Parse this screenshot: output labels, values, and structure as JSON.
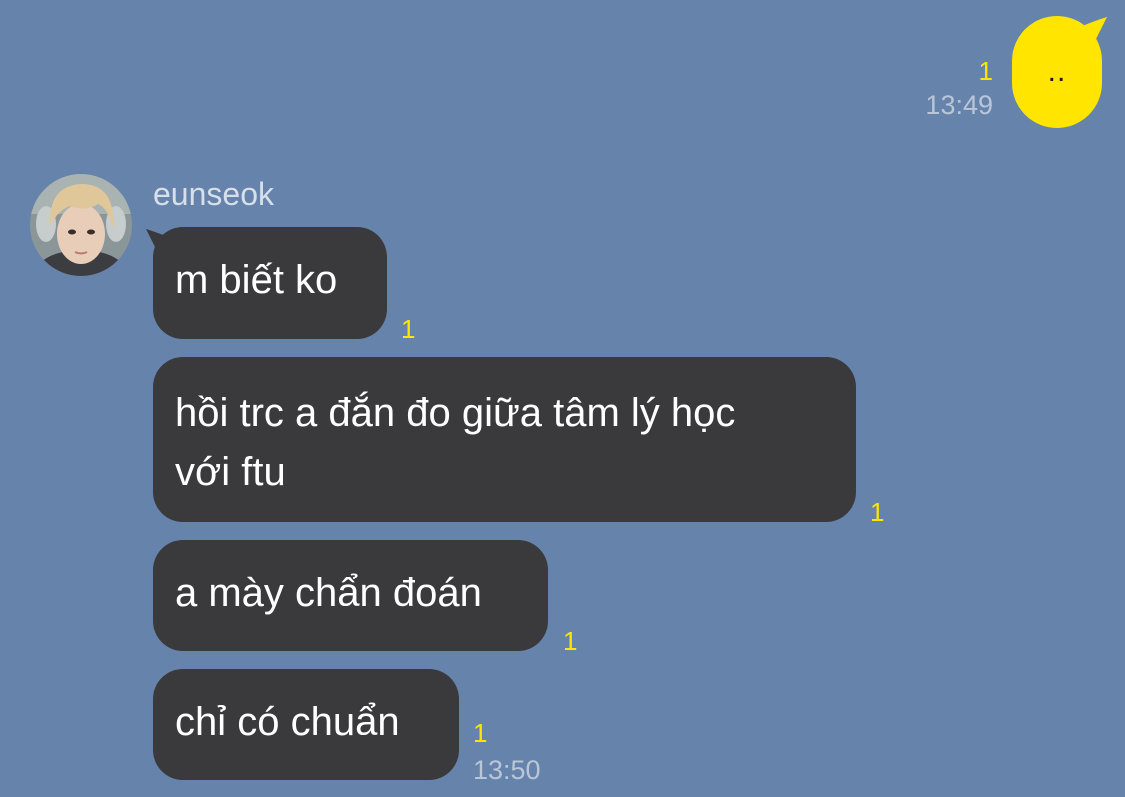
{
  "colors": {
    "background": "#6683AC",
    "outgoing_bubble": "#FFE500",
    "incoming_bubble": "#3A393C",
    "unread_count": "#FFE500",
    "timestamp": "#B9C6D8"
  },
  "outgoing": {
    "text": "..",
    "unread": "1",
    "time": "13:49"
  },
  "incoming": {
    "sender": "eunseok",
    "avatar_icon": "profile-photo",
    "messages": [
      {
        "text": "m biết ko",
        "unread": "1"
      },
      {
        "text": "hồi trc a đắn đo giữa tâm lý học\nvới ftu",
        "unread": "1"
      },
      {
        "text": "a mày chẩn đoán",
        "unread": "1"
      },
      {
        "text": "chỉ có chuẩn",
        "unread": "1"
      }
    ],
    "time": "13:50"
  }
}
